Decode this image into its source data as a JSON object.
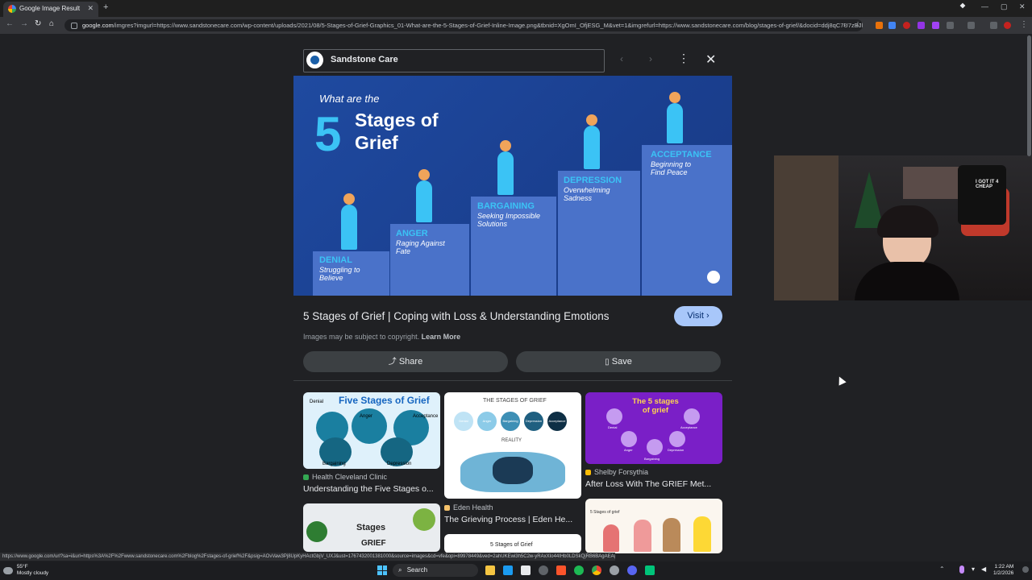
{
  "browser": {
    "tab_title": "Google Image Result",
    "tab_close": "✕",
    "new_tab": "+",
    "url_domain": "google.com",
    "url_rest": "/imgres?imgurl=https://www.sandstonecare.com/wp-content/uploads/2021/08/5-Stages-of-Grief-Graphics_01-What-are-the-5-Stages-of-Grief-Inline-Image.png&tbnid=XgOmI_OfjESG_M&vet=1&imgrefurl=https://www.sandstonecare.com/blog/stages-of-grief/&docid=ddj8qC7U7zBJlM&w...",
    "nav": {
      "back": "←",
      "forward": "→",
      "reload": "↻",
      "home": "⌂"
    },
    "window": {
      "minimize": "—",
      "maximize": "▢",
      "close": "✕"
    }
  },
  "viewer": {
    "source_name": "Sandstone Care",
    "prev": "‹",
    "next": "›",
    "more": "⋮",
    "close": "✕",
    "image": {
      "question": "What are the",
      "number": "5",
      "title_line1": "Stages of",
      "title_line2": "Grief",
      "stages": [
        {
          "name": "DENIAL",
          "sub1": "Struggling to",
          "sub2": "Believe"
        },
        {
          "name": "ANGER",
          "sub1": "Raging Against",
          "sub2": "Fate"
        },
        {
          "name": "BARGAINING",
          "sub1": "Seeking Impossible",
          "sub2": "Solutions"
        },
        {
          "name": "DEPRESSION",
          "sub1": "Overwhelming",
          "sub2": "Sadness"
        },
        {
          "name": "ACCEPTANCE",
          "sub1": "Beginning to",
          "sub2": "Find Peace"
        }
      ]
    },
    "title": "5 Stages of Grief | Coping with Loss & Understanding Emotions",
    "visit_label": "Visit",
    "visit_chevron": "›",
    "copyright_text": "Images may be subject to copyright.",
    "learn_more": "Learn More",
    "share_label": "Share",
    "save_label": "Save"
  },
  "related": [
    {
      "thumb_title": "Five Stages of Grief",
      "source": "Health Cleveland Clinic",
      "title": "Understanding the Five Stages o..."
    },
    {
      "thumb_title": "THE STAGES OF GRIEF",
      "thumb_sub": "REALITY",
      "source": "Eden Health",
      "title": "The Grieving Process | Eden He..."
    },
    {
      "thumb_title": "The 5 stages of grief",
      "source": "Shelby Forsythia",
      "title": "After Loss With The GRIEF Met..."
    },
    {
      "thumb_title": "Stages",
      "thumb_sub": "GRIEF"
    },
    {
      "thumb_title": "5 Stages of Grief"
    },
    {
      "thumb_title": "5 Stages of grief"
    }
  ],
  "thumb_labels": {
    "cleveland": [
      "Denial",
      "Anger",
      "Bargaining",
      "Depression",
      "Acceptance"
    ],
    "eden": [
      "Denial",
      "Anger",
      "Bargaining",
      "Depression",
      "Acceptance"
    ],
    "shelby": [
      "Denial",
      "Acceptance",
      "Anger",
      "Bargaining",
      "Depression"
    ]
  },
  "webcam_shirt": "I GOT IT 4 CHEAP",
  "status_url": "https://www.google.com/url?sa=i&url=https%3A%2F%2Fwww.sandstonecare.com%2Fblog%2Fstages-of-grief%2F&psig=AOvVaw3Pj8UpKyHActGbjV_UXJ&ust=1767432001381000&source=images&cd=vfe&opi=89978449&ved=2ahUKEwi3h5C2w-yRAxXIo44IHb0LDSkQjRB6BAgAEAg",
  "taskbar": {
    "weather_temp": "55°F",
    "weather_desc": "Mostly cloudy",
    "search": "Search",
    "time": "1:22 AM",
    "date": "1/2/2026"
  }
}
